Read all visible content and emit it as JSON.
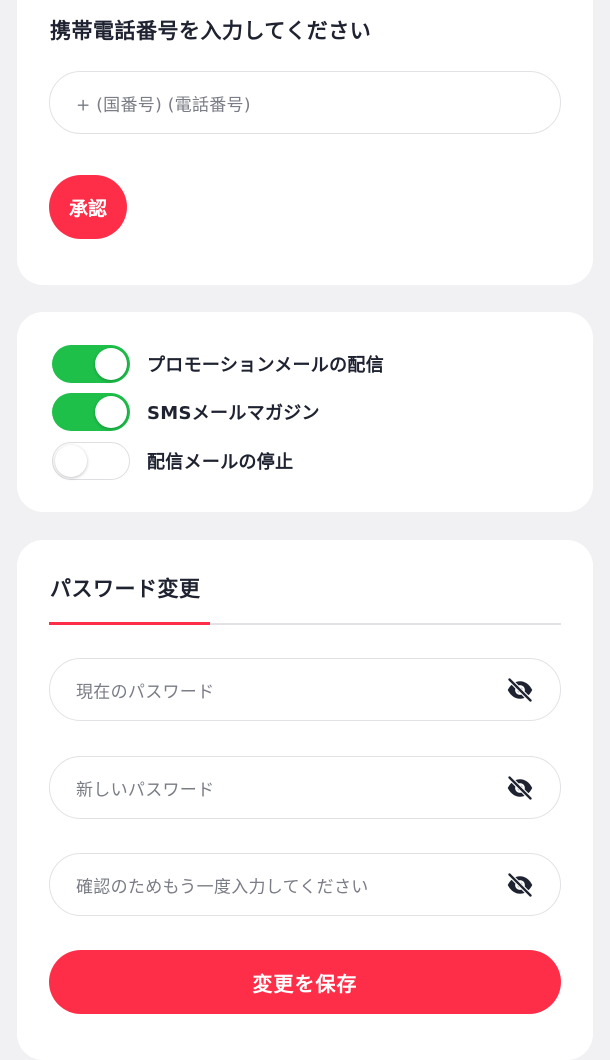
{
  "phone_section": {
    "title": "携帯電話番号を入力してください",
    "phone_placeholder": "+ (国番号) (電話番号)",
    "approve_label": "承認"
  },
  "notifications": {
    "items": [
      {
        "label": "プロモーションメールの配信",
        "enabled": true
      },
      {
        "label": "SMSメールマガジン",
        "enabled": true
      },
      {
        "label": "配信メールの停止",
        "enabled": false
      }
    ]
  },
  "password_section": {
    "title": "パスワード変更",
    "current_placeholder": "現在のパスワード",
    "new_placeholder": "新しいパスワード",
    "confirm_placeholder": "確認のためもう一度入力してください",
    "save_label": "変更を保存"
  },
  "colors": {
    "accent": "#ff2e48",
    "toggle_on": "#1ec04a",
    "background": "#f1f1f3"
  },
  "icons": {
    "password_visibility": "eye-slash-icon"
  }
}
